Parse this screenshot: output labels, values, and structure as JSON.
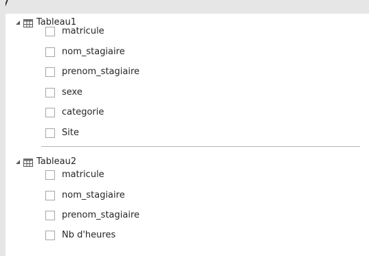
{
  "top_clipped_text": "y",
  "tables": [
    {
      "name": "Tableau1",
      "fields": [
        "matricule",
        "nom_stagiaire",
        "prenom_stagiaire",
        "sexe",
        "categorie",
        "Site"
      ]
    },
    {
      "name": "Tableau2",
      "fields": [
        "matricule",
        "nom_stagiaire",
        "prenom_stagiaire",
        "Nb d'heures"
      ]
    }
  ],
  "icons": {
    "expand": "triangle-expanded-icon",
    "table": "table-grid-icon"
  },
  "colors": {
    "chrome": "#e6e6e6",
    "checkbox_border": "#a6a6a6",
    "divider": "#b3b3b3",
    "text": "#252525"
  }
}
